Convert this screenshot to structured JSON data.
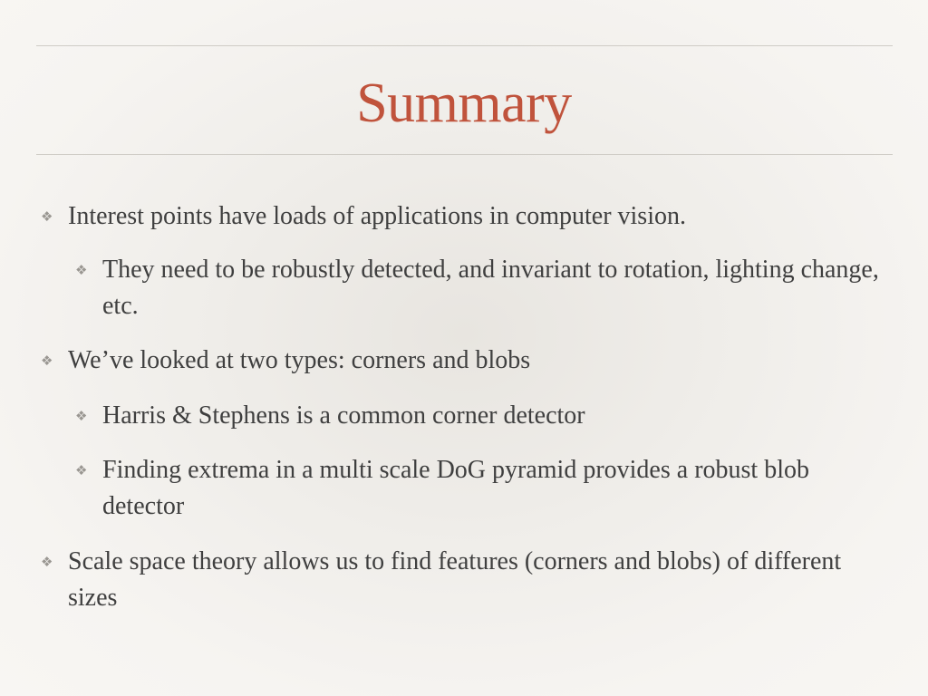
{
  "slide": {
    "title": "Summary",
    "bullet_marker": "❖",
    "items": [
      {
        "level": 1,
        "text": "Interest points have loads of applications in computer vision."
      },
      {
        "level": 2,
        "text": "They need to be robustly detected, and invariant to rotation, lighting change, etc."
      },
      {
        "level": 1,
        "text": "We’ve looked at two types: corners and blobs"
      },
      {
        "level": 2,
        "text": "Harris & Stephens is a common corner detector"
      },
      {
        "level": 2,
        "text": "Finding extrema in a multi scale DoG pyramid provides a robust blob detector"
      },
      {
        "level": 1,
        "text": "Scale space theory allows us to find features (corners and blobs) of different sizes"
      }
    ]
  },
  "colors": {
    "title": "#c0533c",
    "body_text": "#3f3f3f",
    "bullet": "#9a9792",
    "rule": "#cfccc6"
  }
}
